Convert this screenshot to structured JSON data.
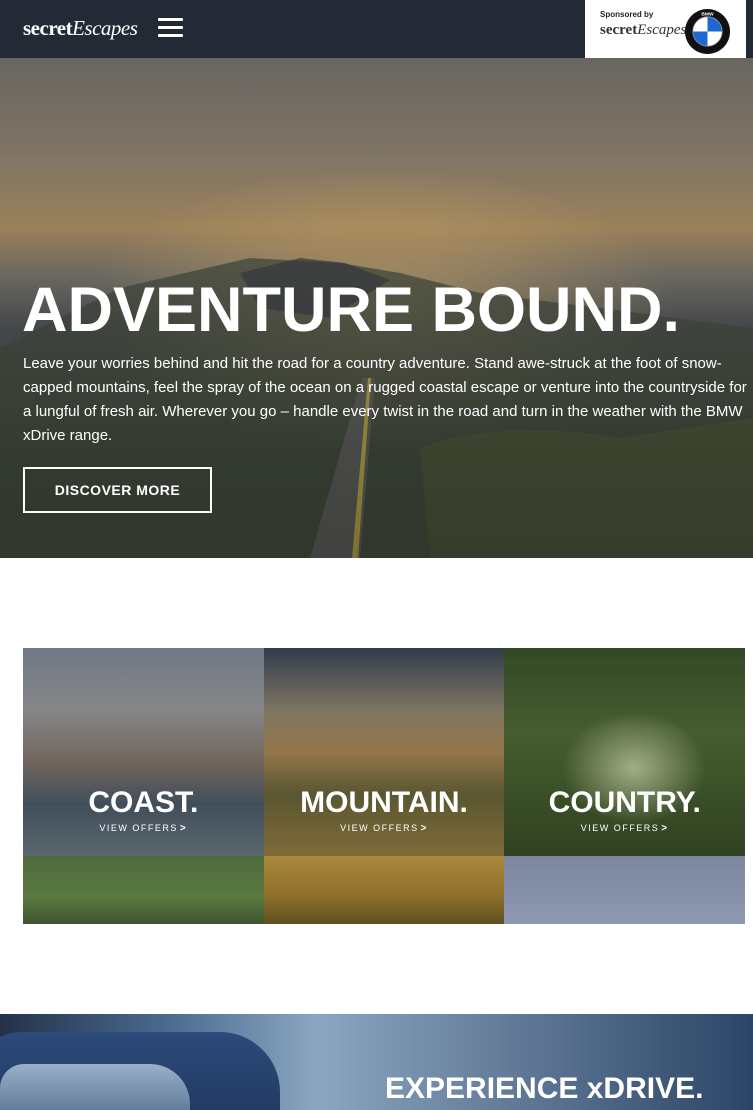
{
  "header": {
    "logo_bold": "secret",
    "logo_italic": "Escapes",
    "sponsor": {
      "label": "Sponsored by",
      "brand_bold": "secret",
      "brand_italic": "Escapes",
      "partner_logo_text": "BMW"
    }
  },
  "hero": {
    "title": "ADVENTURE BOUND.",
    "body": "Leave your worries behind and hit the road for a country adventure. Stand awe-struck at the foot of snow-capped mountains, feel the spray of the ocean on a rugged coastal escape or venture into the countryside for a lungful of fresh air. Wherever you go – handle every twist in the road and turn in the weather with the BMW xDrive range.",
    "cta_label": "DISCOVER MORE"
  },
  "tiles": [
    {
      "title": "COAST.",
      "link_label": "VIEW OFFERS",
      "link_chevron": ">"
    },
    {
      "title": "MOUNTAIN.",
      "link_label": "VIEW OFFERS",
      "link_chevron": ">"
    },
    {
      "title": "COUNTRY.",
      "link_label": "VIEW OFFERS",
      "link_chevron": ">"
    }
  ],
  "banner": {
    "title": "EXPERIENCE xDRIVE."
  },
  "icons": {
    "menu": "hamburger-menu-icon",
    "partner": "bmw-logo-icon",
    "chevron": "chevron-right-icon"
  },
  "colors": {
    "header_bg": "#232a36",
    "text": "#ffffff",
    "bmw_blue": "#1c69d4"
  }
}
